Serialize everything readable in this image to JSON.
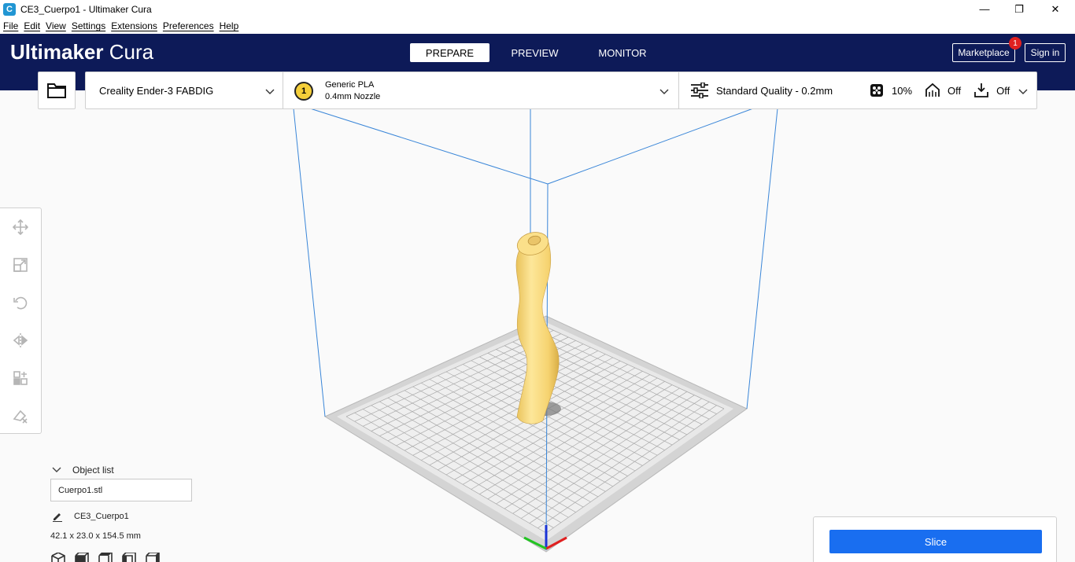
{
  "window": {
    "title": "CE3_Cuerpo1 - Ultimaker Cura",
    "app_icon": "C",
    "minimize_glyph": "—",
    "maximize_glyph": "❐",
    "close_glyph": "✕"
  },
  "menu": [
    "File",
    "Edit",
    "View",
    "Settings",
    "Extensions",
    "Preferences",
    "Help"
  ],
  "header": {
    "logo_bold": "Ultimaker",
    "logo_light": " Cura",
    "tabs": {
      "prepare": "PREPARE",
      "preview": "PREVIEW",
      "monitor": "MONITOR"
    },
    "marketplace": "Marketplace",
    "marketplace_badge": "1",
    "sign_in": "Sign in"
  },
  "toolbar": {
    "printer": "Creality Ender-3 FABDIG",
    "extruder_number": "1",
    "material": "Generic PLA",
    "nozzle": "0.4mm Nozzle",
    "quality": "Standard Quality - 0.2mm",
    "infill": "10%",
    "support": "Off",
    "adhesion": "Off"
  },
  "tools": [
    "move-icon",
    "scale-icon",
    "rotate-icon",
    "mirror-icon",
    "per-model-settings-icon",
    "support-blocker-icon"
  ],
  "object_list": {
    "header": "Object list",
    "item": "Cuerpo1.stl",
    "job_name": "CE3_Cuerpo1",
    "dimensions": "42.1 x 23.0 x 154.5 mm"
  },
  "slice": {
    "label": "Slice"
  },
  "colors": {
    "header_bg": "#0d1a58",
    "accent": "#196ef0",
    "model": "#f8dc7c",
    "build_volume_lines": "#3a86d8",
    "badge": "#e02020"
  }
}
